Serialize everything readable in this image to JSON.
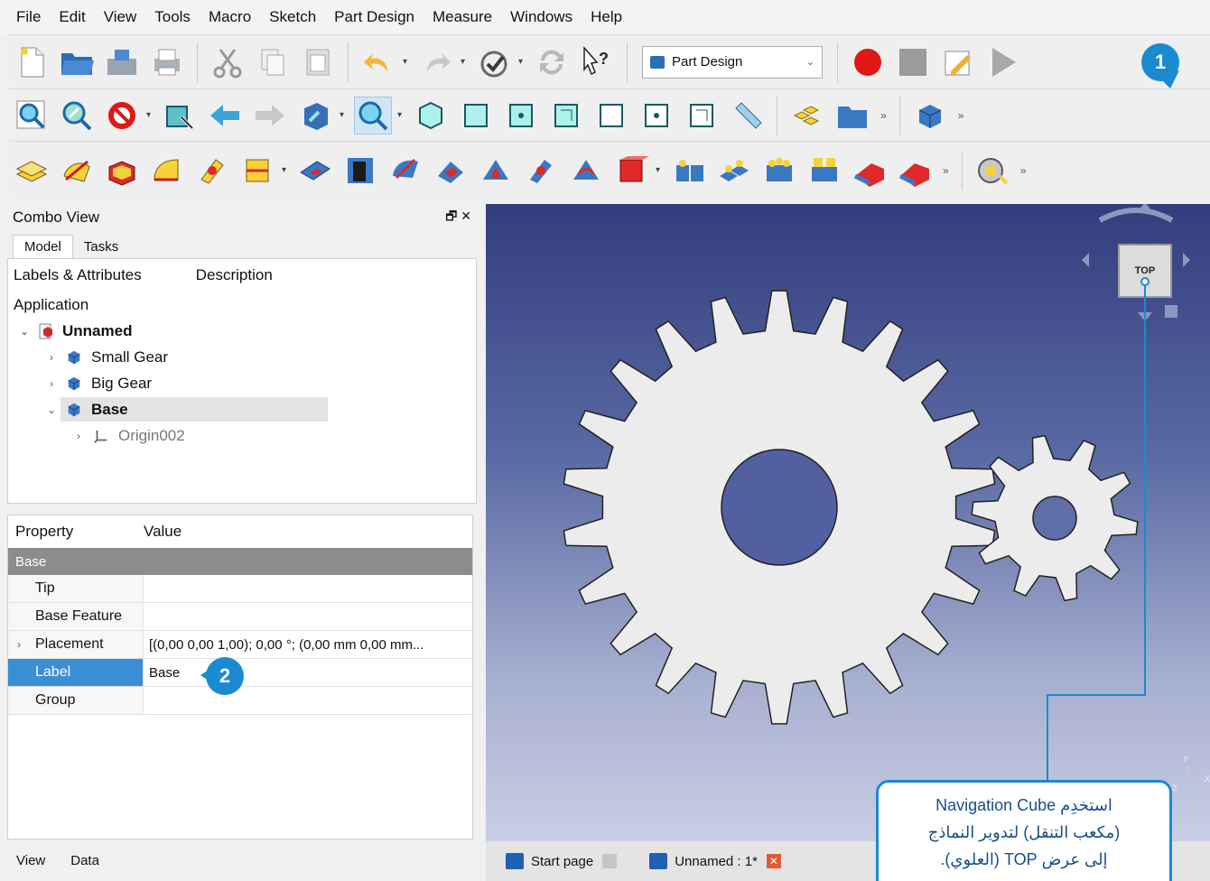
{
  "menu": [
    "File",
    "Edit",
    "View",
    "Tools",
    "Macro",
    "Sketch",
    "Part Design",
    "Measure",
    "Windows",
    "Help"
  ],
  "workbench": {
    "selected": "Part Design"
  },
  "combo": {
    "title": "Combo View",
    "controls": "🗗 ✕",
    "tabs": [
      "Model",
      "Tasks"
    ],
    "tree_headers": [
      "Labels & Attributes",
      "Description"
    ],
    "application_label": "Application",
    "tree": {
      "document": "Unnamed",
      "items": [
        "Small Gear",
        "Big Gear",
        "Base"
      ],
      "child": "Origin002"
    }
  },
  "properties": {
    "headers": [
      "Property",
      "Value"
    ],
    "group": "Base",
    "rows": [
      {
        "name": "Tip",
        "value": ""
      },
      {
        "name": "Base Feature",
        "value": ""
      },
      {
        "name": "Placement",
        "value": "[(0,00 0,00 1,00); 0,00 °; (0,00 mm  0,00 mm..."
      },
      {
        "name": "Label",
        "value": "Base"
      },
      {
        "name": "Group",
        "value": ""
      }
    ],
    "bottom_tabs": [
      "View",
      "Data"
    ]
  },
  "viewport": {
    "navcube_face": "TOP",
    "axis_labels": {
      "y": "Y",
      "z": "Z",
      "x": "X"
    }
  },
  "doc_tabs": [
    {
      "label": "Start page"
    },
    {
      "label": "Unnamed : 1*"
    }
  ],
  "annotations": {
    "badge1": "1",
    "badge2": "2",
    "callout_line1": "استخدِم Navigation Cube",
    "callout_line2": "(مكعب التنقل) لتدوير النماذج",
    "callout_line3": "إلى عرض TOP (العلوي)."
  },
  "colors": {
    "accent": "#1a8bd1",
    "selection": "#3a8fd4",
    "viewport_top": "#323d7d",
    "viewport_bottom": "#c9cee4"
  }
}
